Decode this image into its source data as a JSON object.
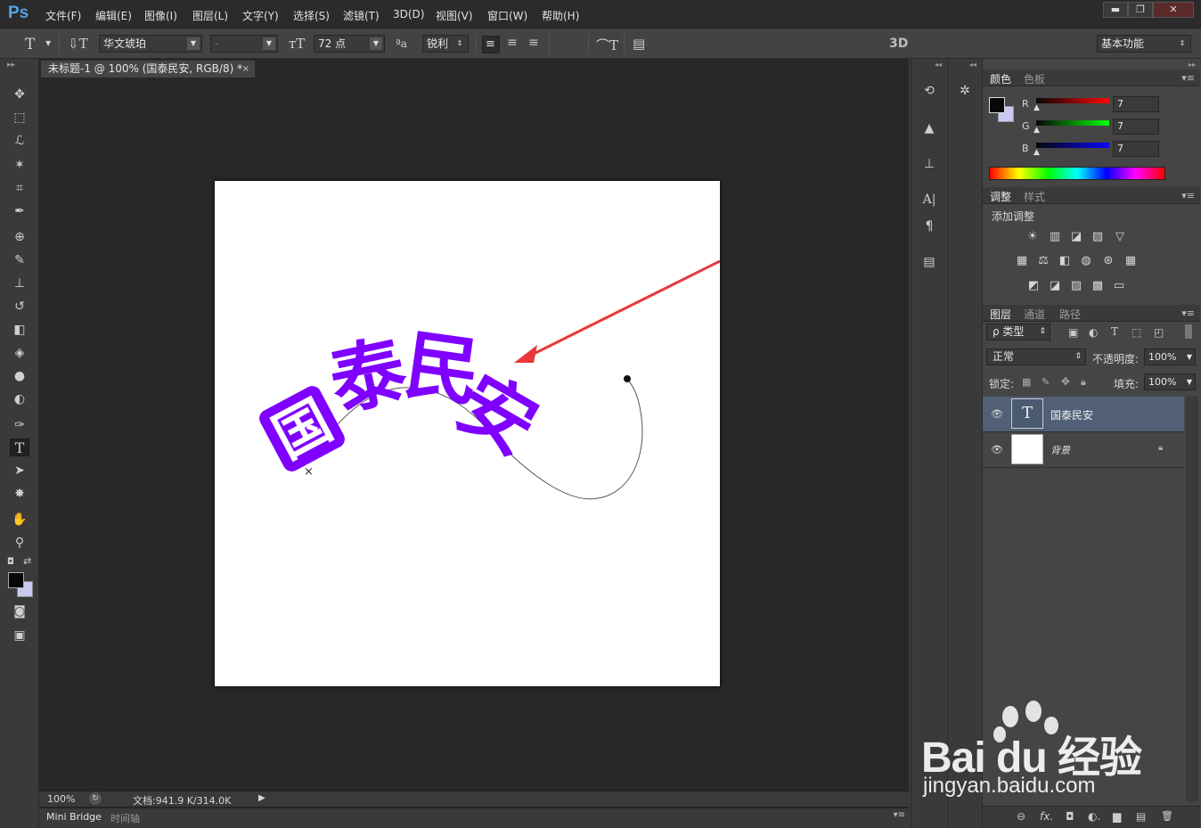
{
  "app": {
    "logo": "Ps"
  },
  "menu": [
    "文件(F)",
    "编辑(E)",
    "图像(I)",
    "图层(L)",
    "文字(Y)",
    "选择(S)",
    "滤镜(T)",
    "3D(D)",
    "视图(V)",
    "窗口(W)",
    "帮助(H)"
  ],
  "window_buttons": [
    "▬",
    "❐",
    "✕"
  ],
  "options": {
    "font_family": "华文琥珀",
    "font_style": "-",
    "font_size": "72 点",
    "antialias": "锐利",
    "text_color": "#7f00ff",
    "mode_3d": "3D",
    "workspace": "基本功能"
  },
  "document": {
    "tab_title": "未标题-1 @ 100% (国泰民安, RGB/8) *",
    "text": "国泰民安",
    "glyphs": [
      "国",
      "泰",
      "民",
      "安"
    ],
    "text_color": "#7f00ff",
    "arrow_color": "#e8383a"
  },
  "status": {
    "zoom": "100%",
    "doc_info": "文档:941.9 K/314.0K"
  },
  "bottom_tabs": [
    "Mini Bridge",
    "时间轴"
  ],
  "color_panel": {
    "tabs": [
      "颜色",
      "色板"
    ],
    "channels": [
      {
        "label": "R",
        "value": "7"
      },
      {
        "label": "G",
        "value": "7"
      },
      {
        "label": "B",
        "value": "7"
      }
    ],
    "foreground": "#070707",
    "background": "#c8c8f0"
  },
  "adjustments_panel": {
    "tabs": [
      "调整",
      "样式"
    ],
    "title": "添加调整",
    "row1": [
      "☀",
      "▥",
      "◪",
      "▨",
      "▽"
    ],
    "row2": [
      "▦",
      "⚖",
      "◧",
      "◍",
      "⊛",
      "▦"
    ],
    "row3": [
      "◩",
      "◪",
      "▨",
      "▩",
      "▭"
    ]
  },
  "layers_panel": {
    "tabs": [
      "图层",
      "通道",
      "路径"
    ],
    "filter": "ρ 类型",
    "blend_mode": "正常",
    "opacity_label": "不透明度:",
    "opacity": "100%",
    "lock_label": "锁定:",
    "fill_label": "填充:",
    "fill": "100%",
    "layers": [
      {
        "name": "国泰民安",
        "type": "T"
      },
      {
        "name": "背景"
      }
    ],
    "footer_icons": [
      "⊖",
      "fx.",
      "◘",
      "◐.",
      "▆",
      "▤",
      "🗑"
    ]
  },
  "watermark": {
    "text": "Bai du 经验",
    "url": "jingyan.baidu.com"
  }
}
